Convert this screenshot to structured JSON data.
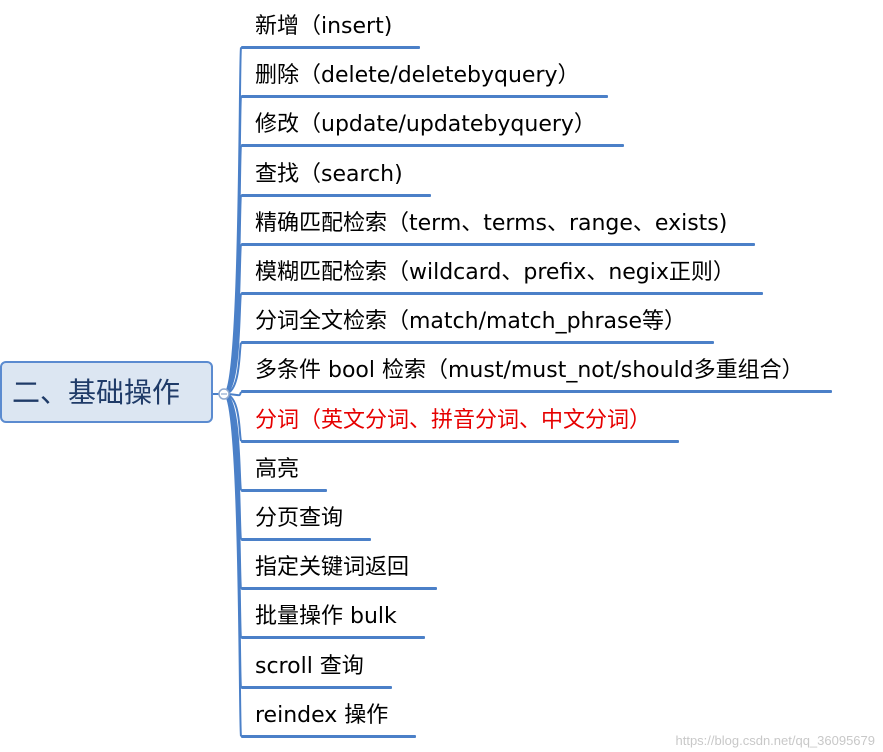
{
  "root": {
    "label": "二、基础操作"
  },
  "branches": [
    {
      "label": "新增（insert)",
      "highlight": false
    },
    {
      "label": "删除（delete/deletebyquery）",
      "highlight": false
    },
    {
      "label": "修改（update/updatebyquery）",
      "highlight": false
    },
    {
      "label": "查找（search)",
      "highlight": false
    },
    {
      "label": "精确匹配检索（term、terms、range、exists)",
      "highlight": false
    },
    {
      "label": "模糊匹配检索（wildcard、prefix、negix正则）",
      "highlight": false
    },
    {
      "label": "分词全文检索（match/match_phrase等）",
      "highlight": false
    },
    {
      "label": "多条件 bool 检索（must/must_not/should多重组合）",
      "highlight": false
    },
    {
      "label": "分词（英文分词、拼音分词、中文分词）",
      "highlight": true
    },
    {
      "label": "高亮",
      "highlight": false
    },
    {
      "label": "分页查询",
      "highlight": false
    },
    {
      "label": "指定关键词返回",
      "highlight": false
    },
    {
      "label": "批量操作 bulk",
      "highlight": false
    },
    {
      "label": "scroll 查询",
      "highlight": false
    },
    {
      "label": "reindex 操作",
      "highlight": false
    }
  ],
  "watermark": "https://blog.csdn.net/qq_36095679",
  "colors": {
    "connector": "#4b80c8",
    "root_fill": "#dce6f2",
    "root_border": "#5b8bd0",
    "root_text": "#1f3b68",
    "highlight_text": "#e60000",
    "text": "#000000"
  }
}
